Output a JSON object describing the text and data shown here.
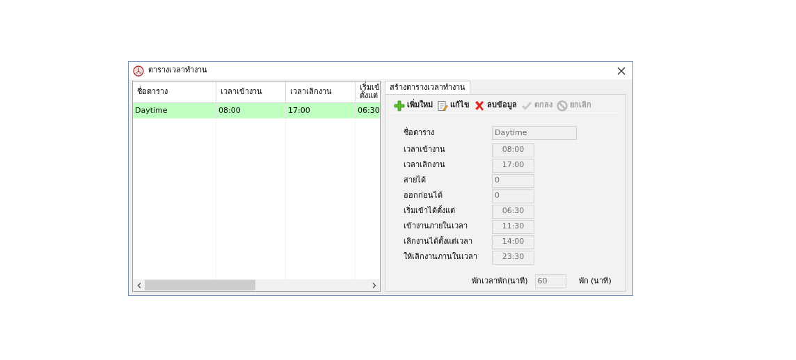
{
  "window": {
    "title": "ตารางเวลาทำงาน"
  },
  "table": {
    "columns": [
      "ชื่อตาราง",
      "เวลาเข้างาน",
      "เวลาเลิกงาน",
      "เริ่มเข้\nตั้งแต่"
    ],
    "rows": [
      {
        "selected": true,
        "cells": [
          "Daytime",
          "08:00",
          "17:00",
          "06:30"
        ]
      }
    ]
  },
  "tab": {
    "label": "สร้างตารางเวลาทำงาน",
    "selected": true
  },
  "toolbar": [
    {
      "kind": "add",
      "label": "เพิ่มใหม่",
      "disabled": false
    },
    {
      "kind": "edit",
      "label": "แก้ไข",
      "disabled": false
    },
    {
      "kind": "delete",
      "label": "ลบข้อมูล",
      "disabled": false
    },
    {
      "kind": "ok",
      "label": "ตกลง",
      "disabled": true
    },
    {
      "kind": "cancel",
      "label": "ยกเลิก",
      "disabled": true
    }
  ],
  "fields": [
    {
      "kind": "name",
      "label": "ชื่อตาราง",
      "value": "Daytime"
    },
    {
      "kind": "time",
      "label": "เวลาเข้างาน",
      "value": "08:00"
    },
    {
      "kind": "time",
      "label": "เวลาเลิกงาน",
      "value": "17:00"
    },
    {
      "kind": "number",
      "label": "สายได้",
      "value": "0"
    },
    {
      "kind": "number",
      "label": "ออกก่อนได้",
      "value": "0"
    },
    {
      "kind": "time",
      "label": "เริ่มเข้าได้ตั้งแต่",
      "value": "06:30"
    },
    {
      "kind": "time",
      "label": "เข้างานภายในเวลา",
      "value": "11:30"
    },
    {
      "kind": "time",
      "label": "เลิกงานได้ตั้งแต่เวลา",
      "value": "14:00"
    },
    {
      "kind": "time",
      "label": "ให้เลิกงานภานในเวลา",
      "value": "23:30"
    }
  ],
  "break": {
    "label": "พักเวลาพัก(นาที)",
    "value": "60",
    "unit": "พัก (นาที)"
  }
}
